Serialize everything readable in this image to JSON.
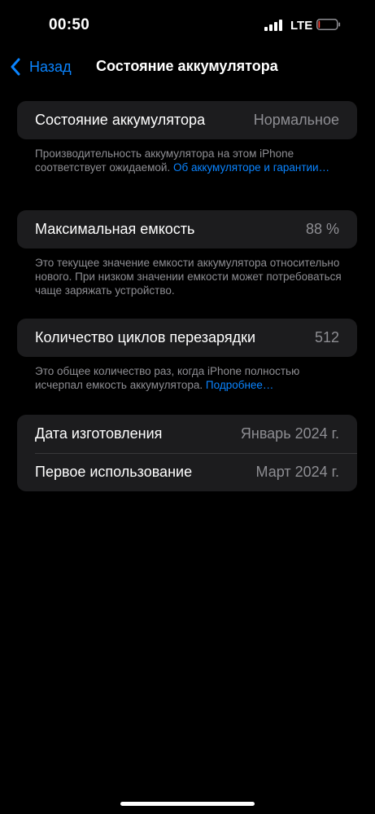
{
  "status_bar": {
    "time": "00:50",
    "network": "LTE",
    "signal_bars": 4,
    "battery_level": 0.08,
    "battery_color": "#ff453a"
  },
  "nav": {
    "back_label": "Назад",
    "title": "Состояние аккумулятора"
  },
  "sections": {
    "health": {
      "label": "Состояние аккумулятора",
      "value": "Нормальное",
      "footer_text": "Производительность аккумулятора на этом iPhone соответствует ожидаемой. ",
      "footer_link": "Об аккумуляторе и гарантии…"
    },
    "capacity": {
      "label": "Максимальная емкость",
      "value": "88 %",
      "footer_text": "Это текущее значение емкости аккумулятора относительно нового. При низком значении емкости может потребоваться чаще заряжать устройство."
    },
    "cycles": {
      "label": "Количество циклов перезарядки",
      "value": "512",
      "footer_text": "Это общее количество раз, когда iPhone полностью исчерпал емкость аккумулятора. ",
      "footer_link": "Подробнее…"
    },
    "dates": {
      "manufacture_label": "Дата изготовления",
      "manufacture_value": "Январь 2024 г.",
      "first_use_label": "Первое использование",
      "first_use_value": "Март 2024 г."
    }
  },
  "colors": {
    "accent": "#0a84ff",
    "card_bg": "#1c1c1e",
    "secondary_text": "#8e8e93"
  }
}
